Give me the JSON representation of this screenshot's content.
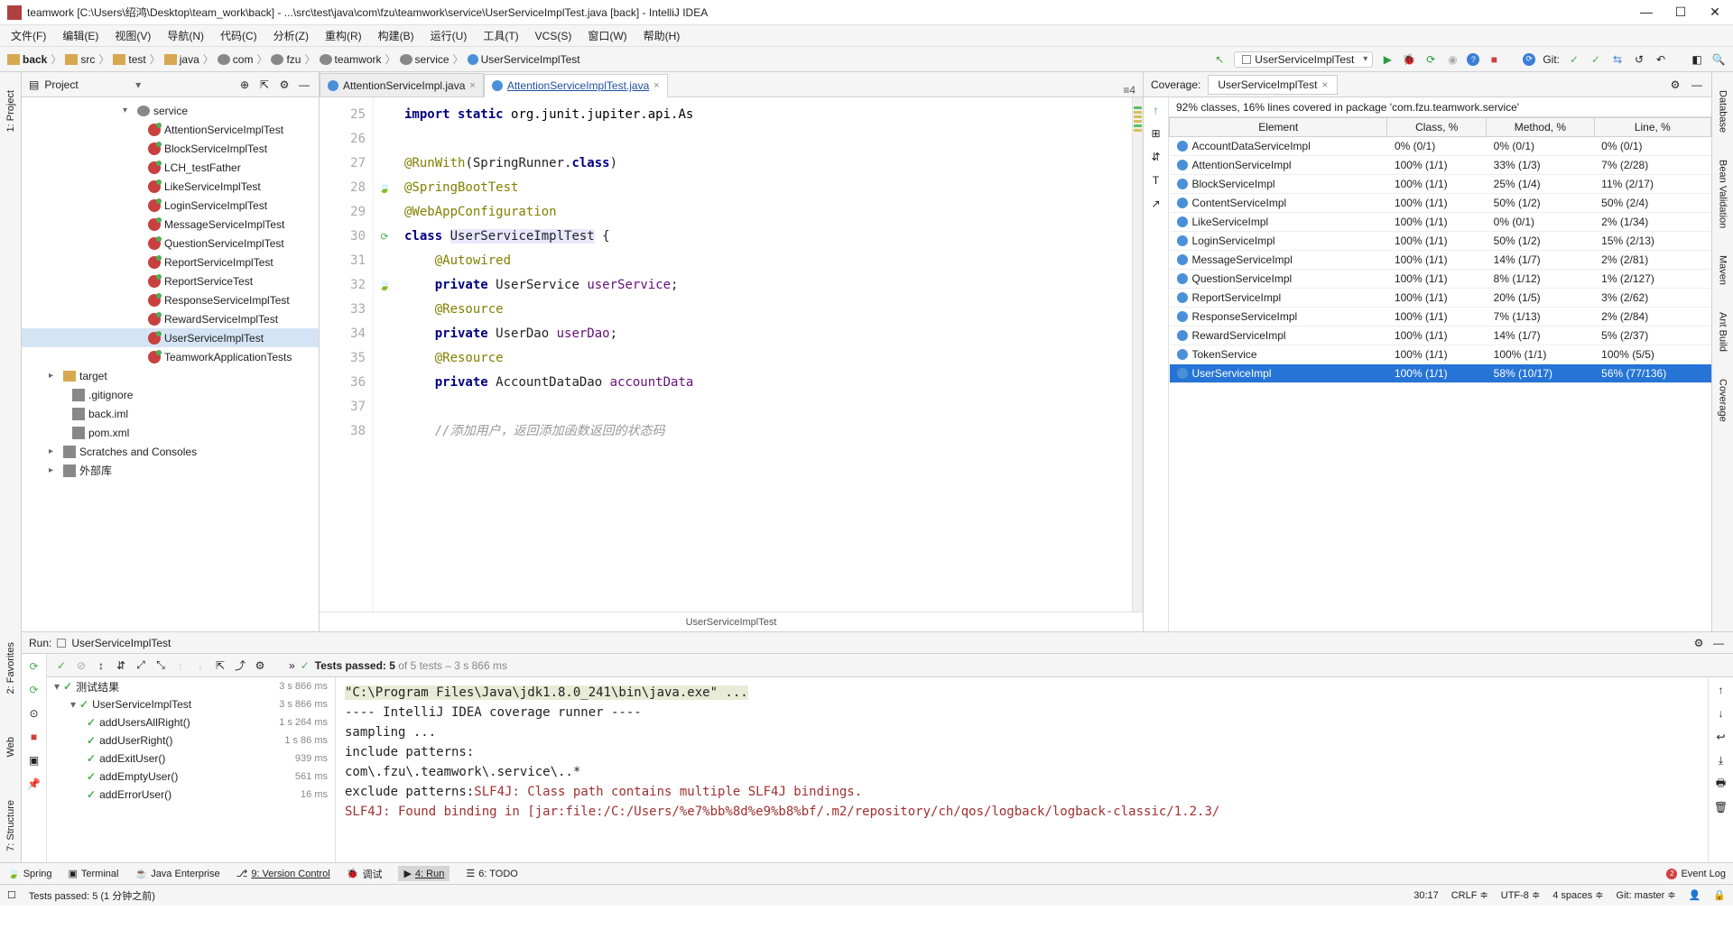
{
  "titlebar": {
    "text": "teamwork [C:\\Users\\绍鸿\\Desktop\\team_work\\back] - ...\\src\\test\\java\\com\\fzu\\teamwork\\service\\UserServiceImplTest.java [back] - IntelliJ IDEA"
  },
  "menubar": [
    "文件(F)",
    "编辑(E)",
    "视图(V)",
    "导航(N)",
    "代码(C)",
    "分析(Z)",
    "重构(R)",
    "构建(B)",
    "运行(U)",
    "工具(T)",
    "VCS(S)",
    "窗口(W)",
    "帮助(H)"
  ],
  "breadcrumbs": [
    {
      "label": "back",
      "icon": "folder"
    },
    {
      "label": "src",
      "icon": "folder"
    },
    {
      "label": "test",
      "icon": "folder"
    },
    {
      "label": "java",
      "icon": "folder"
    },
    {
      "label": "com",
      "icon": "pkg"
    },
    {
      "label": "fzu",
      "icon": "pkg"
    },
    {
      "label": "teamwork",
      "icon": "pkg"
    },
    {
      "label": "service",
      "icon": "pkg"
    },
    {
      "label": "UserServiceImplTest",
      "icon": "class"
    }
  ],
  "runConfig": "UserServiceImplTest",
  "gitLabel": "Git:",
  "leftRail": [
    "1: Project",
    "2: Favorites",
    "Web",
    "7: Structure"
  ],
  "rightRail": [
    "Database",
    "Bean Validation",
    "Maven",
    "Ant Build",
    "Coverage"
  ],
  "projectPanel": {
    "title": "Project",
    "tree": [
      {
        "level": 0,
        "expander": "▾",
        "icon": "pkg",
        "label": "service"
      },
      {
        "level": 1,
        "icon": "test",
        "label": "AttentionServiceImplTest"
      },
      {
        "level": 1,
        "icon": "test",
        "label": "BlockServiceImplTest"
      },
      {
        "level": 1,
        "icon": "test",
        "label": "LCH_testFather"
      },
      {
        "level": 1,
        "icon": "test",
        "label": "LikeServiceImplTest"
      },
      {
        "level": 1,
        "icon": "test",
        "label": "LoginServiceImplTest"
      },
      {
        "level": 1,
        "icon": "test",
        "label": "MessageServiceImplTest"
      },
      {
        "level": 1,
        "icon": "test",
        "label": "QuestionServiceImplTest"
      },
      {
        "level": 1,
        "icon": "test",
        "label": "ReportServiceImplTest"
      },
      {
        "level": 1,
        "icon": "test",
        "label": "ReportServiceTest"
      },
      {
        "level": 1,
        "icon": "test",
        "label": "ResponseServiceImplTest"
      },
      {
        "level": 1,
        "icon": "test",
        "label": "RewardServiceImplTest"
      },
      {
        "level": 1,
        "icon": "test",
        "label": "UserServiceImplTest",
        "selected": true
      },
      {
        "level": 2,
        "icon": "test",
        "label": "TeamworkApplicationTests",
        "class_style": true
      },
      {
        "level": "file0",
        "expander": "▸",
        "icon": "folder",
        "label": "target"
      },
      {
        "level": "file1",
        "icon": "file",
        "label": ".gitignore"
      },
      {
        "level": "file1",
        "icon": "file",
        "label": "back.iml"
      },
      {
        "level": "file1",
        "icon": "file",
        "label": "pom.xml"
      },
      {
        "level": "file0",
        "expander": "▸",
        "icon": "scratch",
        "label": "Scratches and Consoles"
      },
      {
        "level": "file0",
        "expander": "▸",
        "icon": "lib",
        "label": "外部库"
      }
    ]
  },
  "editor": {
    "tabs": [
      {
        "name": "AttentionServiceImpl.java",
        "active": false
      },
      {
        "name": "AttentionServiceImplTest.java",
        "active": true
      }
    ],
    "tabCount": "≡4",
    "lines": [
      25,
      26,
      27,
      28,
      29,
      30,
      31,
      32,
      33,
      34,
      35,
      36,
      37,
      38
    ],
    "crumbFooter": "UserServiceImplTest"
  },
  "coverage": {
    "header": "Coverage:",
    "tab": "UserServiceImplTest",
    "summary": "92% classes, 16% lines covered in package 'com.fzu.teamwork.service'",
    "columns": [
      "Element",
      "Class, %",
      "Method, %",
      "Line, %"
    ],
    "rows": [
      {
        "el": "AccountDataServiceImpl",
        "c": "0% (0/1)",
        "m": "0% (0/1)",
        "l": "0% (0/1)"
      },
      {
        "el": "AttentionServiceImpl",
        "c": "100% (1/1)",
        "m": "33% (1/3)",
        "l": "7% (2/28)"
      },
      {
        "el": "BlockServiceImpl",
        "c": "100% (1/1)",
        "m": "25% (1/4)",
        "l": "11% (2/17)"
      },
      {
        "el": "ContentServiceImpl",
        "c": "100% (1/1)",
        "m": "50% (1/2)",
        "l": "50% (2/4)"
      },
      {
        "el": "LikeServiceImpl",
        "c": "100% (1/1)",
        "m": "0% (0/1)",
        "l": "2% (1/34)"
      },
      {
        "el": "LoginServiceImpl",
        "c": "100% (1/1)",
        "m": "50% (1/2)",
        "l": "15% (2/13)"
      },
      {
        "el": "MessageServiceImpl",
        "c": "100% (1/1)",
        "m": "14% (1/7)",
        "l": "2% (2/81)"
      },
      {
        "el": "QuestionServiceImpl",
        "c": "100% (1/1)",
        "m": "8% (1/12)",
        "l": "1% (2/127)"
      },
      {
        "el": "ReportServiceImpl",
        "c": "100% (1/1)",
        "m": "20% (1/5)",
        "l": "3% (2/62)"
      },
      {
        "el": "ResponseServiceImpl",
        "c": "100% (1/1)",
        "m": "7% (1/13)",
        "l": "2% (2/84)"
      },
      {
        "el": "RewardServiceImpl",
        "c": "100% (1/1)",
        "m": "14% (1/7)",
        "l": "5% (2/37)"
      },
      {
        "el": "TokenService",
        "c": "100% (1/1)",
        "m": "100% (1/1)",
        "l": "100% (5/5)"
      },
      {
        "el": "UserServiceImpl",
        "c": "100% (1/1)",
        "m": "58% (10/17)",
        "l": "56% (77/136)",
        "sel": true
      }
    ]
  },
  "runPanel": {
    "title": "Run:",
    "config": "UserServiceImplTest",
    "testsPassed": "Tests passed: 5",
    "testsPassedSuffix": " of 5 tests – 3 s 866 ms",
    "tree": [
      {
        "indent": 0,
        "exp": "▾",
        "name": "测试结果",
        "time": "3 s 866 ms"
      },
      {
        "indent": 1,
        "exp": "▾",
        "name": "UserServiceImplTest",
        "time": "3 s 866 ms"
      },
      {
        "indent": 2,
        "name": "addUsersAllRight()",
        "time": "1 s 264 ms"
      },
      {
        "indent": 2,
        "name": "addUserRight()",
        "time": "1 s 86 ms"
      },
      {
        "indent": 2,
        "name": "addExitUser()",
        "time": "939 ms"
      },
      {
        "indent": 2,
        "name": "addEmptyUser()",
        "time": "561 ms"
      },
      {
        "indent": 2,
        "name": "addErrorUser()",
        "time": "16 ms"
      }
    ],
    "console": {
      "l1": "\"C:\\Program Files\\Java\\jdk1.8.0_241\\bin\\java.exe\" ...",
      "l2": "---- IntelliJ IDEA coverage runner ---- ",
      "l3": "sampling ...",
      "l4": "include patterns:",
      "l5": "com\\.fzu\\.teamwork\\.service\\..*",
      "l6a": "exclude patterns:",
      "l6b": "SLF4J: Class path contains multiple SLF4J bindings.",
      "l7": "SLF4J: Found binding in [jar:file:/C:/Users/%e7%bb%8d%e9%b8%bf/.m2/repository/ch/qos/logback/logback-classic/1.2.3/"
    }
  },
  "bottomTabs": {
    "spring": "Spring",
    "terminal": "Terminal",
    "javaEnterprise": "Java Enterprise",
    "versionControl": "9: Version Control",
    "debug": "调试",
    "run": "4: Run",
    "todo": "6: TODO",
    "eventLog": "Event Log"
  },
  "statusbar": {
    "left": "Tests passed: 5 (1 分钟之前)",
    "pos": "30:17",
    "eol": "CRLF",
    "enc": "UTF-8",
    "indent": "4 spaces",
    "git": "Git: master"
  }
}
